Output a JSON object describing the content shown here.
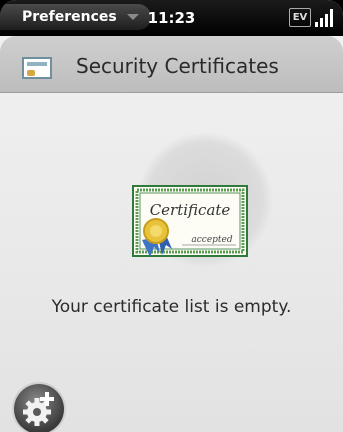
{
  "status_bar": {
    "app_menu_label": "Preferences",
    "time": "11:23",
    "network_badge": "EV"
  },
  "header": {
    "title": "Security Certificates",
    "icon": "certificate-icon"
  },
  "empty_state": {
    "certificate_title": "Certificate",
    "certificate_stamp": "accepted",
    "message": "Your certificate list is empty."
  },
  "toolbar": {
    "add_icon": "add-certificate-gear-icon"
  },
  "colors": {
    "title_bar": "#c6c6c6",
    "background": "#ececec",
    "certificate_border": "#2f7a3a",
    "ribbon_blue": "#3f73c6",
    "seal_gold": "#e7c23a"
  }
}
